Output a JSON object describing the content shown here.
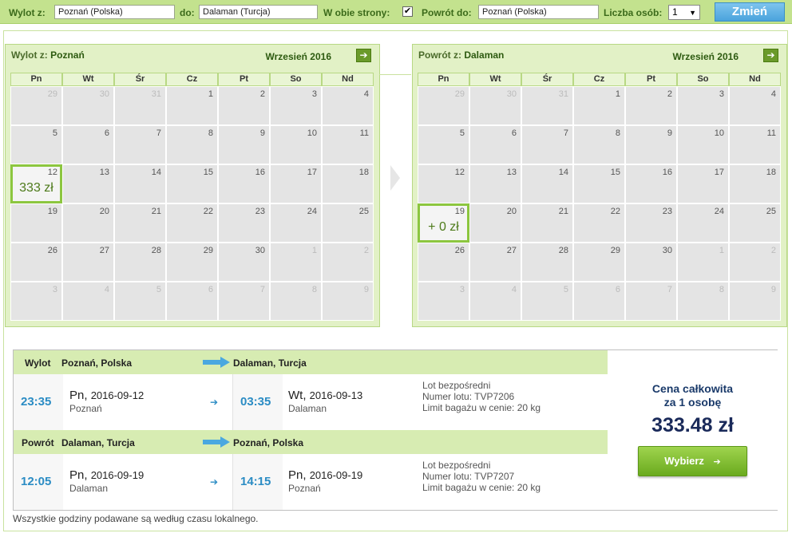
{
  "search": {
    "from_label": "Wylot z:",
    "from_value": "Poznań (Polska)",
    "to_label": "do:",
    "to_value": "Dalaman (Turcja)",
    "roundtrip_label": "W obie strony:",
    "roundtrip_checked": "✔",
    "return_label": "Powrót do:",
    "return_value": "Poznań (Polska)",
    "persons_label": "Liczba osób:",
    "persons_value": "1",
    "change_button": "Zmień"
  },
  "weekdays": [
    "Pn",
    "Wt",
    "Śr",
    "Cz",
    "Pt",
    "So",
    "Nd"
  ],
  "calendars": [
    {
      "title_prefix": "Wylot z:",
      "city": "Poznań",
      "month": "Wrzesień 2016",
      "days": [
        "29",
        "30",
        "31",
        "1",
        "2",
        "3",
        "4",
        "5",
        "6",
        "7",
        "8",
        "9",
        "10",
        "11",
        "12",
        "13",
        "14",
        "15",
        "16",
        "17",
        "18",
        "19",
        "20",
        "21",
        "22",
        "23",
        "24",
        "25",
        "26",
        "27",
        "28",
        "29",
        "30",
        "1",
        "2",
        "3",
        "4",
        "5",
        "6",
        "7",
        "8",
        "9"
      ],
      "selected_day": "12",
      "selected_price": "333 zł"
    },
    {
      "title_prefix": "Powrót z:",
      "city": "Dalaman",
      "month": "Wrzesień 2016",
      "days": [
        "29",
        "30",
        "31",
        "1",
        "2",
        "3",
        "4",
        "5",
        "6",
        "7",
        "8",
        "9",
        "10",
        "11",
        "12",
        "13",
        "14",
        "15",
        "16",
        "17",
        "18",
        "19",
        "20",
        "21",
        "22",
        "23",
        "24",
        "25",
        "26",
        "27",
        "28",
        "29",
        "30",
        "1",
        "2",
        "3",
        "4",
        "5",
        "6",
        "7",
        "8",
        "9"
      ],
      "selected_day": "19",
      "selected_price": "+ 0 zł"
    }
  ],
  "legs": [
    {
      "label": "Wylot",
      "from_city": "Poznań, Polska",
      "to_city": "Dalaman, Turcja",
      "dep_time": "23:35",
      "dep_day": "Pn,",
      "dep_date": "2016-09-12",
      "dep_place": "Poznań",
      "arr_time": "03:35",
      "arr_day": "Wt,",
      "arr_date": "2016-09-13",
      "arr_place": "Dalaman",
      "info_direct": "Lot bezpośredni",
      "info_flight": "Numer lotu: TVP7206",
      "info_baggage": "Limit bagażu w cenie: 20 kg"
    },
    {
      "label": "Powrót",
      "from_city": "Dalaman, Turcja",
      "to_city": "Poznań, Polska",
      "dep_time": "12:05",
      "dep_day": "Pn,",
      "dep_date": "2016-09-19",
      "dep_place": "Dalaman",
      "arr_time": "14:15",
      "arr_day": "Pn,",
      "arr_date": "2016-09-19",
      "arr_place": "Poznań",
      "info_direct": "Lot bezpośredni",
      "info_flight": "Numer lotu: TVP7207",
      "info_baggage": "Limit bagażu w cenie: 20 kg"
    }
  ],
  "price": {
    "label_line1": "Cena całkowita",
    "label_line2": "za 1 osobę",
    "value": "333.48 zł",
    "button": "Wybierz"
  },
  "note": "Wszystkie godziny podawane są według czasu lokalnego.",
  "icons": {
    "next_month": "arrow-right-icon",
    "route_arrow": "route-arrow-icon",
    "small_arrow": "small-arrow-right-icon",
    "choose_arrow": "arrow-right-icon"
  },
  "colors": {
    "bar": "#c3e28e",
    "calendar_bg": "#e2f1c6",
    "selected": "#8cc63f",
    "time_blue": "#2b8cc4",
    "button_green": "#6aaa1e",
    "change_blue": "#4aa3dc"
  }
}
